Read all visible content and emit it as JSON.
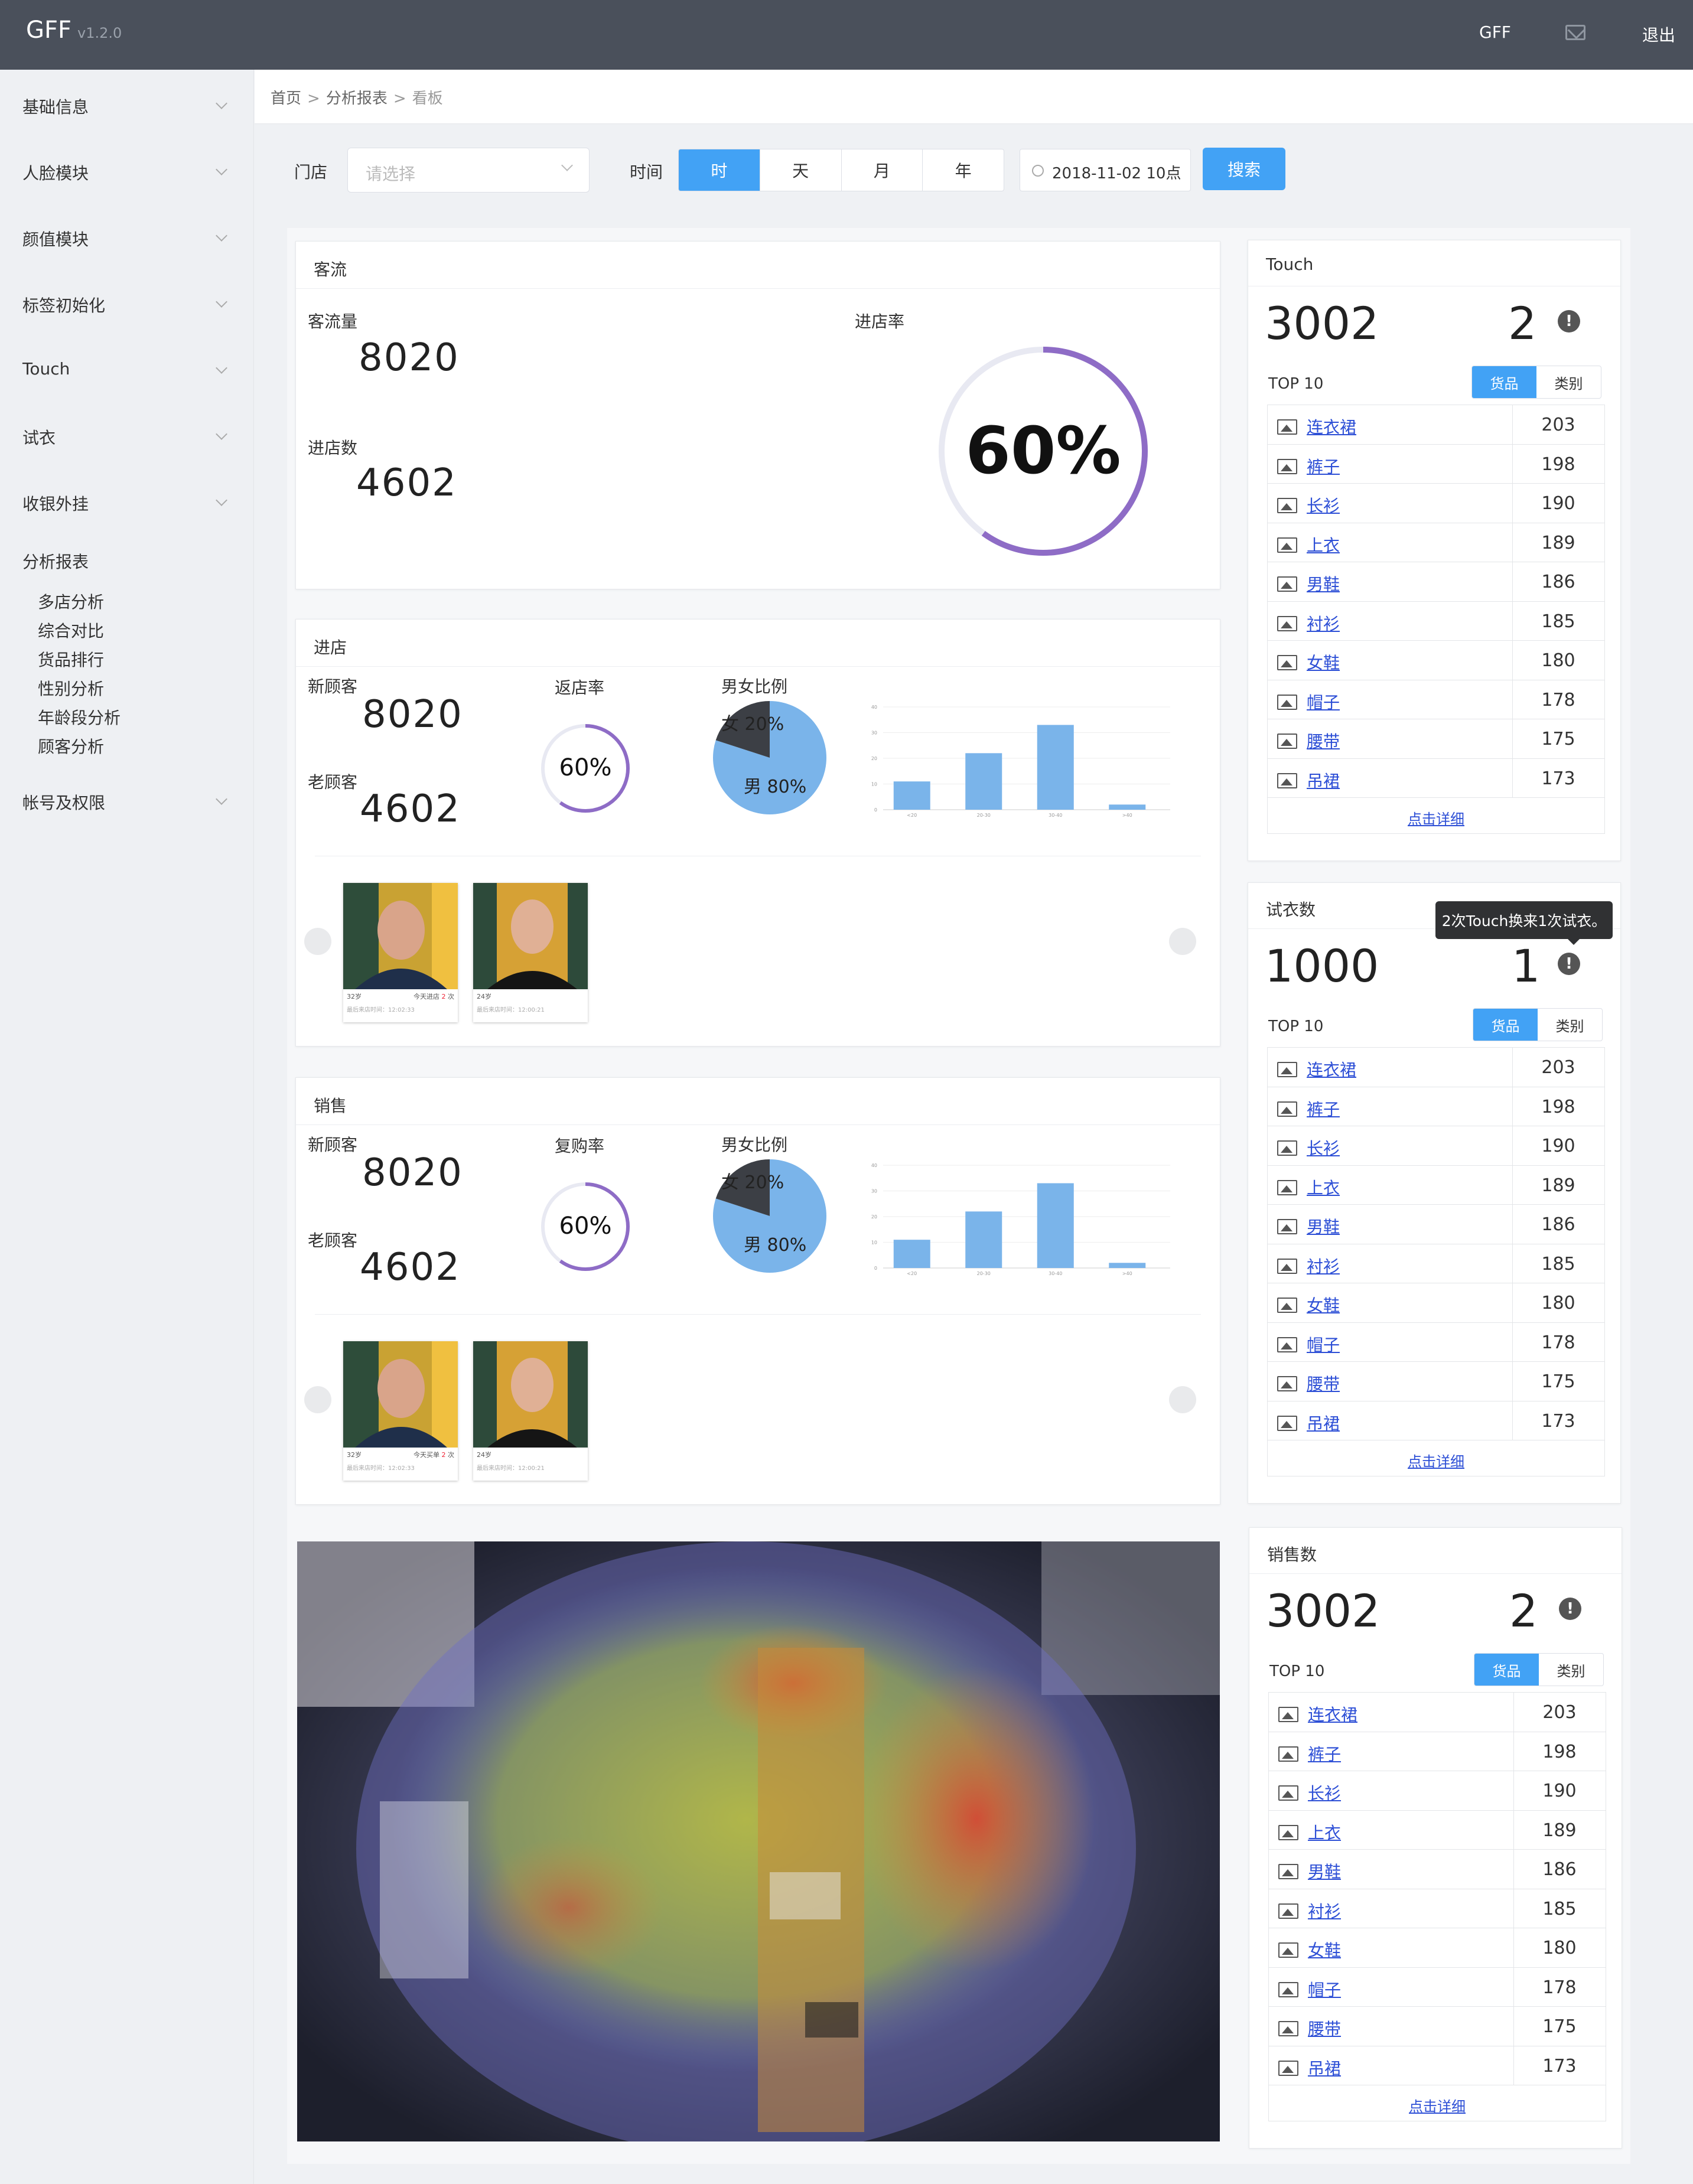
{
  "app": {
    "name": "GFF",
    "version": "v1.2.0",
    "user": "GFF",
    "logout": "退出"
  },
  "sidebar": {
    "items": [
      {
        "label": "基础信息"
      },
      {
        "label": "人脸模块"
      },
      {
        "label": "颜值模块"
      },
      {
        "label": "标签初始化"
      },
      {
        "label": "Touch"
      },
      {
        "label": "试衣"
      },
      {
        "label": "收银外挂"
      }
    ],
    "expanded": {
      "label": "分析报表",
      "children": [
        "多店分析",
        "综合对比",
        "货品排行",
        "性别分析",
        "年龄段分析",
        "顾客分析"
      ]
    },
    "last": {
      "label": "帐号及权限"
    }
  },
  "breadcrumb": [
    "首页",
    "分析报表",
    "看板"
  ],
  "breadcrumb_sep": ">",
  "filters": {
    "store_label": "门店",
    "store_placeholder": "请选择",
    "time_label": "时间",
    "time_options": [
      "时",
      "天",
      "月",
      "年"
    ],
    "time_active": "时",
    "datetime": "2018-11-02 10点",
    "search": "搜索"
  },
  "traffic": {
    "title": "客流",
    "flow_label": "客流量",
    "flow_value": "8020",
    "enter_label": "进店数",
    "enter_value": "4602",
    "rate_label": "进店率",
    "rate_value": "60%",
    "rate": 0.6
  },
  "enter_panel": {
    "title": "进店",
    "new_label": "新顾客",
    "new_value": "8020",
    "old_label": "老顾客",
    "old_value": "4602",
    "rate_label": "返店率",
    "rate_value": "60%",
    "rate": 0.6,
    "ratio_label": "男女比例",
    "female_text": "女 20%",
    "male_text": "男 80%",
    "faces": [
      {
        "age": "32岁",
        "info": "今天进店",
        "count": "2",
        "unit": "次",
        "time": "最后来店时间：12:02:33"
      },
      {
        "age": "24岁",
        "info": "",
        "count": "",
        "unit": "",
        "time": "最后来店时间：12:00:21"
      }
    ]
  },
  "sales_panel": {
    "title": "销售",
    "new_label": "新顾客",
    "new_value": "8020",
    "old_label": "老顾客",
    "old_value": "4602",
    "rate_label": "复购率",
    "rate_value": "60%",
    "rate": 0.6,
    "ratio_label": "男女比例",
    "female_text": "女 20%",
    "male_text": "男 80%",
    "faces": [
      {
        "age": "32岁",
        "info": "今天买单",
        "count": "2",
        "unit": "次",
        "time": "最后来店时间：12:02:33"
      },
      {
        "age": "24岁",
        "info": "",
        "count": "",
        "unit": "",
        "time": "最后来店时间：12:00:21"
      }
    ]
  },
  "touch": {
    "title": "Touch",
    "total": "3002",
    "count": "2",
    "top_label": "TOP 10",
    "tabs": [
      "货品",
      "类别"
    ],
    "more": "点击详细"
  },
  "tryon": {
    "title": "试衣数",
    "total": "1000",
    "count": "1",
    "top_label": "TOP 10",
    "tabs": [
      "货品",
      "类别"
    ],
    "more": "点击详细",
    "tooltip": "2次Touch换来1次试衣。"
  },
  "salescount": {
    "title": "销售数",
    "total": "3002",
    "count": "2",
    "top_label": "TOP 10",
    "tabs": [
      "货品",
      "类别"
    ],
    "more": "点击详细"
  },
  "rank": [
    {
      "name": "连衣裙",
      "value": "203"
    },
    {
      "name": "裤子",
      "value": "198"
    },
    {
      "name": "长衫",
      "value": "190"
    },
    {
      "name": "上衣",
      "value": "189"
    },
    {
      "name": "男鞋",
      "value": "186"
    },
    {
      "name": "衬衫",
      "value": "185"
    },
    {
      "name": "女鞋",
      "value": "180"
    },
    {
      "name": "帽子",
      "value": "178"
    },
    {
      "name": "腰带",
      "value": "175"
    },
    {
      "name": "吊裙",
      "value": "173"
    }
  ],
  "chart_data": [
    {
      "type": "pie",
      "labels": [
        "女",
        "男"
      ],
      "values": [
        20,
        80
      ],
      "colors": [
        "#3c3f45",
        "#7ab4ea"
      ]
    },
    {
      "type": "bar",
      "categories": [
        "<20",
        "20-30",
        "30-40",
        ">40"
      ],
      "values": [
        11,
        22,
        33,
        2
      ],
      "ylim": [
        0,
        40
      ],
      "yticks": [
        0,
        10,
        20,
        30,
        40
      ],
      "color": "#7ab4ea"
    },
    {
      "type": "pie",
      "labels": [
        "女",
        "男"
      ],
      "values": [
        20,
        80
      ],
      "colors": [
        "#3c3f45",
        "#7ab4ea"
      ]
    },
    {
      "type": "bar",
      "categories": [
        "<20",
        "20-30",
        "30-40",
        ">40"
      ],
      "values": [
        11,
        22,
        33,
        2
      ],
      "ylim": [
        0,
        40
      ],
      "yticks": [
        0,
        10,
        20,
        30,
        40
      ],
      "color": "#7ab4ea"
    }
  ],
  "colors": {
    "accent": "#42a2f5",
    "ring": "#8e6cc6",
    "link": "#2d4fd6",
    "topbar": "#4a505b"
  }
}
